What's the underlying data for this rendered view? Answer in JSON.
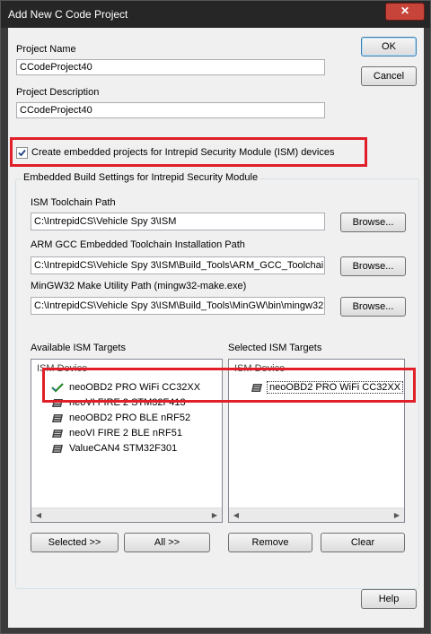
{
  "window": {
    "title": "Add New C Code Project",
    "close_label": "✕"
  },
  "project_name": {
    "label": "Project Name",
    "value": "CCodeProject40"
  },
  "project_description": {
    "label": "Project Description",
    "value": "CCodeProject40"
  },
  "buttons": {
    "ok": "OK",
    "cancel": "Cancel",
    "help": "Help",
    "browse": "Browse...",
    "selected": "Selected >>",
    "all": "All >>",
    "remove": "Remove",
    "clear": "Clear"
  },
  "ism_checkbox": {
    "label": "Create embedded projects for Intrepid Security Module (ISM) devices",
    "checked": true
  },
  "embedded_group": {
    "title": "Embedded Build Settings for Intrepid Security Module",
    "toolchain": {
      "label": "ISM Toolchain Path",
      "value": "C:\\IntrepidCS\\Vehicle Spy 3\\ISM"
    },
    "arm_gcc": {
      "label": "ARM GCC Embedded Toolchain Installation Path",
      "value": "C:\\IntrepidCS\\Vehicle Spy 3\\ISM\\Build_Tools\\ARM_GCC_Toolchai"
    },
    "mingw": {
      "label": "MinGW32 Make Utility Path (mingw32-make.exe)",
      "value": "C:\\IntrepidCS\\Vehicle Spy 3\\ISM\\Build_Tools\\MinGW\\bin\\mingw32"
    }
  },
  "available_targets": {
    "title": "Available ISM Targets",
    "header": "ISM Device",
    "items": [
      "neoOBD2 PRO WiFi CC32XX",
      "neoVI FIRE 2 STM32F413",
      "neoOBD2 PRO BLE nRF52",
      "neoVI FIRE 2 BLE nRF51",
      "ValueCAN4 STM32F301"
    ]
  },
  "selected_targets": {
    "title": "Selected ISM Targets",
    "header": "ISM Device",
    "items": [
      "neoOBD2 PRO WiFi CC32XX"
    ]
  },
  "colors": {
    "highlight": "#e01f28",
    "titlebar": "#262626",
    "dialog_bg": "#f0f0f0"
  }
}
